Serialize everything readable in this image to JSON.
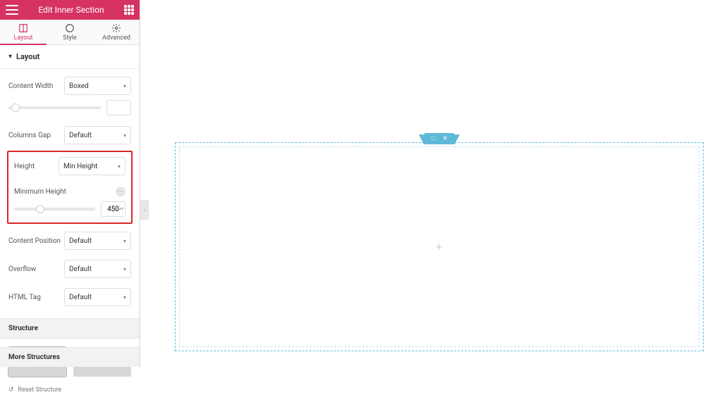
{
  "header": {
    "title": "Edit Inner Section"
  },
  "tabs": {
    "layout": "Layout",
    "style": "Style",
    "advanced": "Advanced"
  },
  "section": {
    "layout": "Layout"
  },
  "controls": {
    "content_width": {
      "label": "Content Width",
      "value": "Boxed"
    },
    "columns_gap": {
      "label": "Columns Gap",
      "value": "Default"
    },
    "height": {
      "label": "Height",
      "value": "Min Height"
    },
    "min_height": {
      "label": "Minimum Height",
      "value": "450"
    },
    "content_position": {
      "label": "Content Position",
      "value": "Default"
    },
    "overflow": {
      "label": "Overflow",
      "value": "Default"
    },
    "html_tag": {
      "label": "HTML Tag",
      "value": "Default"
    }
  },
  "structure": {
    "title": "Structure",
    "reset": "Reset Structure",
    "more": "More Structures"
  },
  "canvas": {
    "drag": ":::",
    "close": "✕",
    "plus": "+"
  }
}
